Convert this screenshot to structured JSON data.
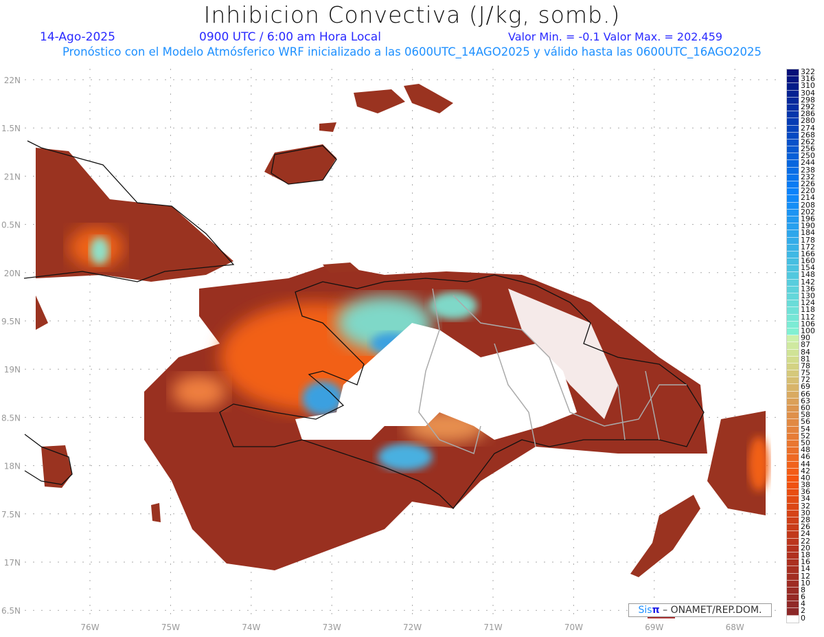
{
  "title": "Inhibicion Convectiva (J/kg, somb.)",
  "date": "14-Ago-2025",
  "time": "0900 UTC / 6:00 am Hora Local",
  "minmax": "Valor Min. = -0.1  Valor Max. = 202.459",
  "model_line": "Pronóstico con el Modelo Atmósferico WRF inicializado a las 0600UTC_14AGO2025 y válido hasta las  0600UTC_16AGO2025",
  "lat_labels": [
    "22N",
    "1.5N",
    "21N",
    "0.5N",
    "20N",
    "9.5N",
    "19N",
    "8.5N",
    "18N",
    "7.5N",
    "17N",
    "6.5N"
  ],
  "lon_labels": [
    "76W",
    "75W",
    "74W",
    "73W",
    "72W",
    "71W",
    "70W",
    "69W",
    "68W"
  ],
  "colorbar_levels": [
    "322",
    "316",
    "310",
    "304",
    "298",
    "292",
    "286",
    "280",
    "274",
    "268",
    "262",
    "256",
    "250",
    "244",
    "238",
    "232",
    "226",
    "220",
    "214",
    "208",
    "202",
    "196",
    "190",
    "184",
    "178",
    "172",
    "166",
    "160",
    "154",
    "148",
    "142",
    "136",
    "130",
    "124",
    "118",
    "112",
    "106",
    "100",
    "90",
    "87",
    "84",
    "81",
    "78",
    "75",
    "72",
    "69",
    "66",
    "63",
    "60",
    "58",
    "56",
    "54",
    "52",
    "50",
    "48",
    "46",
    "44",
    "42",
    "40",
    "38",
    "36",
    "34",
    "32",
    "30",
    "28",
    "26",
    "24",
    "22",
    "20",
    "18",
    "16",
    "14",
    "12",
    "10",
    "8",
    "6",
    "4",
    "2",
    "0"
  ],
  "credit": {
    "logo_a": "Sis",
    "logo_b": "π",
    "text": "– ONAMET/REP.DOM."
  },
  "colors": {
    "low": "#8b2a22",
    "mid": "#f05a10",
    "high": "#7ee0d0",
    "blue": "#1e80e0"
  }
}
